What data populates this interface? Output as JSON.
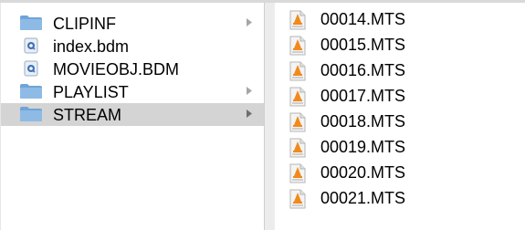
{
  "left_column": {
    "items": [
      {
        "label": "CLIPINF",
        "icon": "folder-icon",
        "has_children": true,
        "selected": false
      },
      {
        "label": "index.bdm",
        "icon": "quicktime-document-icon",
        "has_children": false,
        "selected": false
      },
      {
        "label": "MOVIEOBJ.BDM",
        "icon": "quicktime-document-icon",
        "has_children": false,
        "selected": false
      },
      {
        "label": "PLAYLIST",
        "icon": "folder-icon",
        "has_children": true,
        "selected": false
      },
      {
        "label": "STREAM",
        "icon": "folder-icon",
        "has_children": true,
        "selected": true
      }
    ]
  },
  "right_column": {
    "files": [
      {
        "label": "00014.MTS",
        "icon": "vlc-mts-file-icon"
      },
      {
        "label": "00015.MTS",
        "icon": "vlc-mts-file-icon"
      },
      {
        "label": "00016.MTS",
        "icon": "vlc-mts-file-icon"
      },
      {
        "label": "00017.MTS",
        "icon": "vlc-mts-file-icon"
      },
      {
        "label": "00018.MTS",
        "icon": "vlc-mts-file-icon"
      },
      {
        "label": "00019.MTS",
        "icon": "vlc-mts-file-icon"
      },
      {
        "label": "00020.MTS",
        "icon": "vlc-mts-file-icon"
      },
      {
        "label": "00021.MTS",
        "icon": "vlc-mts-file-icon"
      }
    ]
  },
  "colors": {
    "selection": "#d4d4d4",
    "folder": "#6fa4d6",
    "chevron": "#a6a6a6"
  }
}
